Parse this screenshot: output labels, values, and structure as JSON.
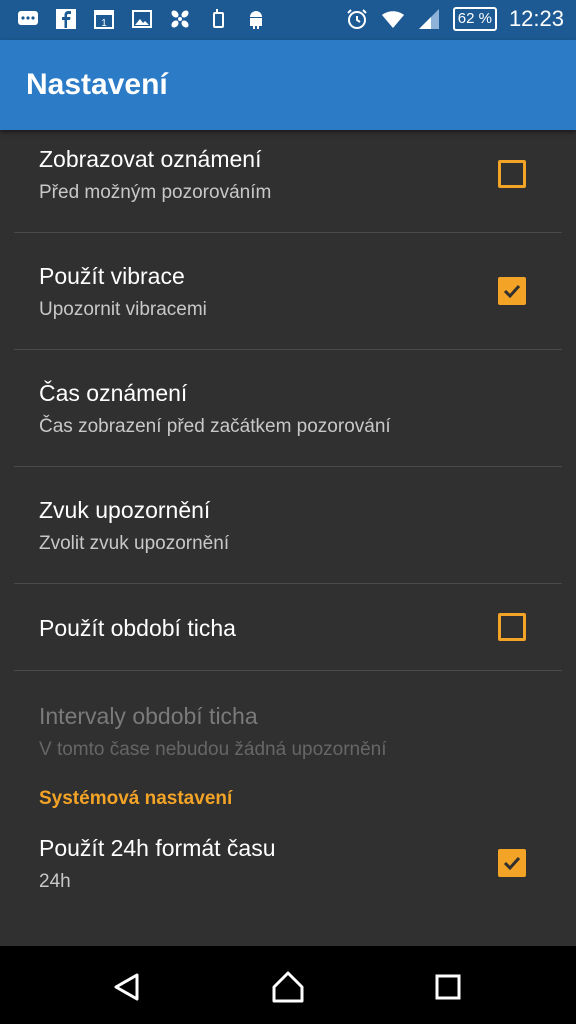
{
  "status_bar": {
    "battery": "62 %",
    "time": "12:23"
  },
  "app_bar": {
    "title": "Nastavení"
  },
  "settings": [
    {
      "title": "Zobrazovat oznámení",
      "summary": "Před možným pozorováním",
      "checked": false
    },
    {
      "title": "Použít vibrace",
      "summary": "Upozornit vibracemi",
      "checked": true
    },
    {
      "title": "Čas oznámení",
      "summary": "Čas zobrazení před začátkem pozorování"
    },
    {
      "title": "Zvuk upozornění",
      "summary": "Zvolit zvuk upozornění"
    },
    {
      "title": "Použít období ticha",
      "checked": false
    },
    {
      "title": "Intervaly období ticha",
      "summary": "V tomto čase nebudou žádná upozornění",
      "disabled": true
    }
  ],
  "section": {
    "header": "Systémová nastavení",
    "items": [
      {
        "title": "Použít 24h formát času",
        "summary": "24h",
        "checked": true
      }
    ]
  },
  "colors": {
    "accent": "#f3a326",
    "app_bar": "#2b7bc6",
    "status_bar": "#1d5a94",
    "background": "#303030"
  },
  "icons": {
    "status_left": [
      "message-icon",
      "facebook-icon",
      "calendar-icon",
      "image-icon",
      "fan-icon",
      "device-icon",
      "android-icon"
    ],
    "status_right": [
      "alarm-icon",
      "wifi-icon",
      "signal-icon",
      "battery-icon"
    ],
    "nav": [
      "back-icon",
      "home-icon",
      "recents-icon"
    ]
  }
}
